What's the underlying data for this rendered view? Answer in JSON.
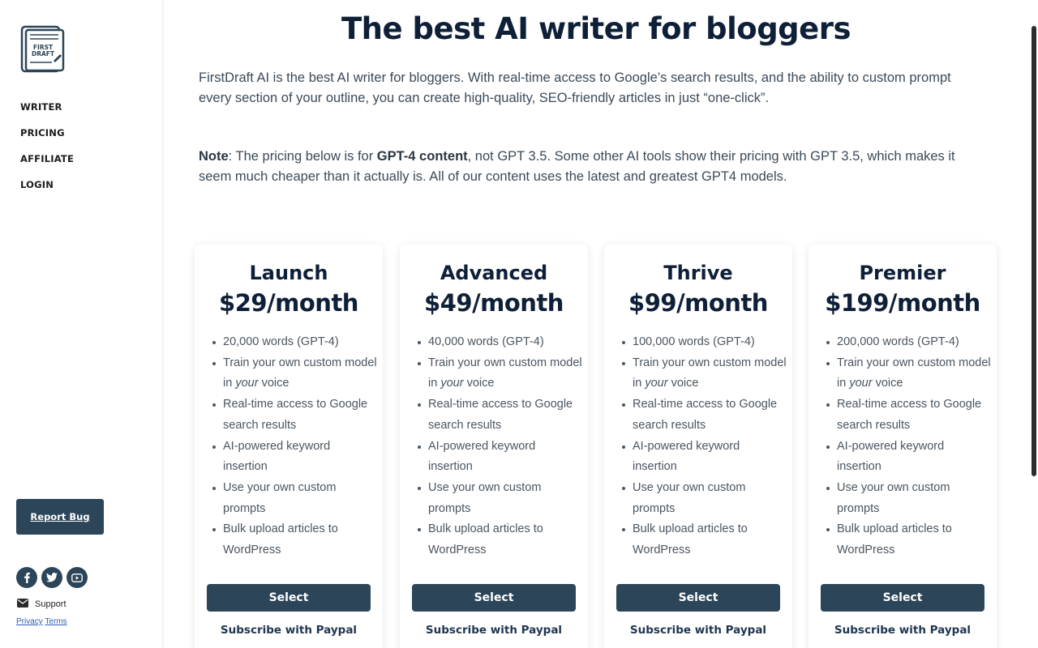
{
  "logo": {
    "text_line1": "FIRST",
    "text_line2": "DRAFT"
  },
  "nav": [
    {
      "label": "WRITER"
    },
    {
      "label": "PRICING"
    },
    {
      "label": "AFFILIATE"
    },
    {
      "label": "LOGIN"
    }
  ],
  "report_bug": "Report Bug",
  "socials": [
    "facebook-icon",
    "twitter-icon",
    "youtube-icon"
  ],
  "support": "Support",
  "legal": {
    "privacy": "Privacy",
    "terms": "Terms"
  },
  "main": {
    "title": "The best AI writer for bloggers",
    "intro": "FirstDraft AI is the best AI writer for bloggers. With real-time access to Google’s search results, and the ability to custom prompt every section of your outline, you can create high-quality, SEO-friendly articles in just “one-click”.",
    "note": {
      "label": "Note",
      "text1": ": The pricing below is for ",
      "bold": "GPT-4 content",
      "text2": ", not GPT 3.5. Some other AI tools show their pricing with GPT 3.5, which makes it seem much cheaper than it actually is. All of our content uses the latest and greatest GPT4 models."
    }
  },
  "plans": [
    {
      "name": "Launch",
      "price": "$29/month",
      "words": "20,000 words (GPT-4)"
    },
    {
      "name": "Advanced",
      "price": "$49/month",
      "words": "40,000 words (GPT-4)"
    },
    {
      "name": "Thrive",
      "price": "$99/month",
      "words": "100,000 words (GPT-4)"
    },
    {
      "name": "Premier",
      "price": "$199/month",
      "words": "200,000 words (GPT-4)"
    }
  ],
  "features": {
    "train_pre": "Train your own custom model in ",
    "train_em": "your",
    "train_post": " voice",
    "realtime": "Real-time access to Google search results",
    "keyword": "AI-powered keyword insertion",
    "prompts": "Use your own custom prompts",
    "bulk": "Bulk upload articles to WordPress"
  },
  "buttons": {
    "select": "Select",
    "paypal": "Subscribe with Paypal"
  },
  "colors": {
    "primary": "#2c4559",
    "heading": "#0e1f38",
    "body_text": "#3c4a57",
    "link": "#2f5db0"
  }
}
